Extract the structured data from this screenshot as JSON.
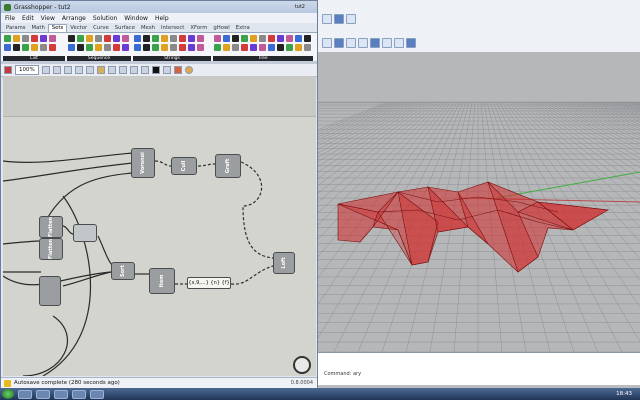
{
  "gh": {
    "title": "Grasshopper - tut2",
    "doc_name": "tut2",
    "menu": [
      "File",
      "Edit",
      "View",
      "Arrange",
      "Solution",
      "Window",
      "Help"
    ],
    "tabs": [
      "Params",
      "Math",
      "Sets",
      "Vector",
      "Curve",
      "Surface",
      "Mesh",
      "Intersect",
      "XForm",
      "gHowl",
      "Extra"
    ],
    "active_tab": "Sets",
    "ribbon_groups": [
      "List",
      "Sequence",
      "Strings",
      "Tree"
    ],
    "zoom": "100%",
    "status": "Autosave complete (280 seconds ago)",
    "version": "0.8.0004"
  },
  "components": {
    "voronoi": "Voronoi",
    "cull": "Cull",
    "graft": "Graft",
    "flatten1": "Flatten",
    "flatten2": "Flatten",
    "sort": "Sort",
    "item": "Item",
    "loft": "Loft",
    "panel_text": "{x,9,...}  {n} {f}"
  },
  "rhino": {
    "command_prompt": "Command:",
    "command_text": "ary"
  },
  "taskbar": {
    "clock": "18:43"
  },
  "colors": {
    "ribbon_footer": "#23272c",
    "surface_fill": "#d22a2a",
    "surface_edge": "#7a0e0e",
    "grid_line": "#8e9094",
    "axis_x": "#b84a4a",
    "axis_y": "#3fae3f"
  }
}
